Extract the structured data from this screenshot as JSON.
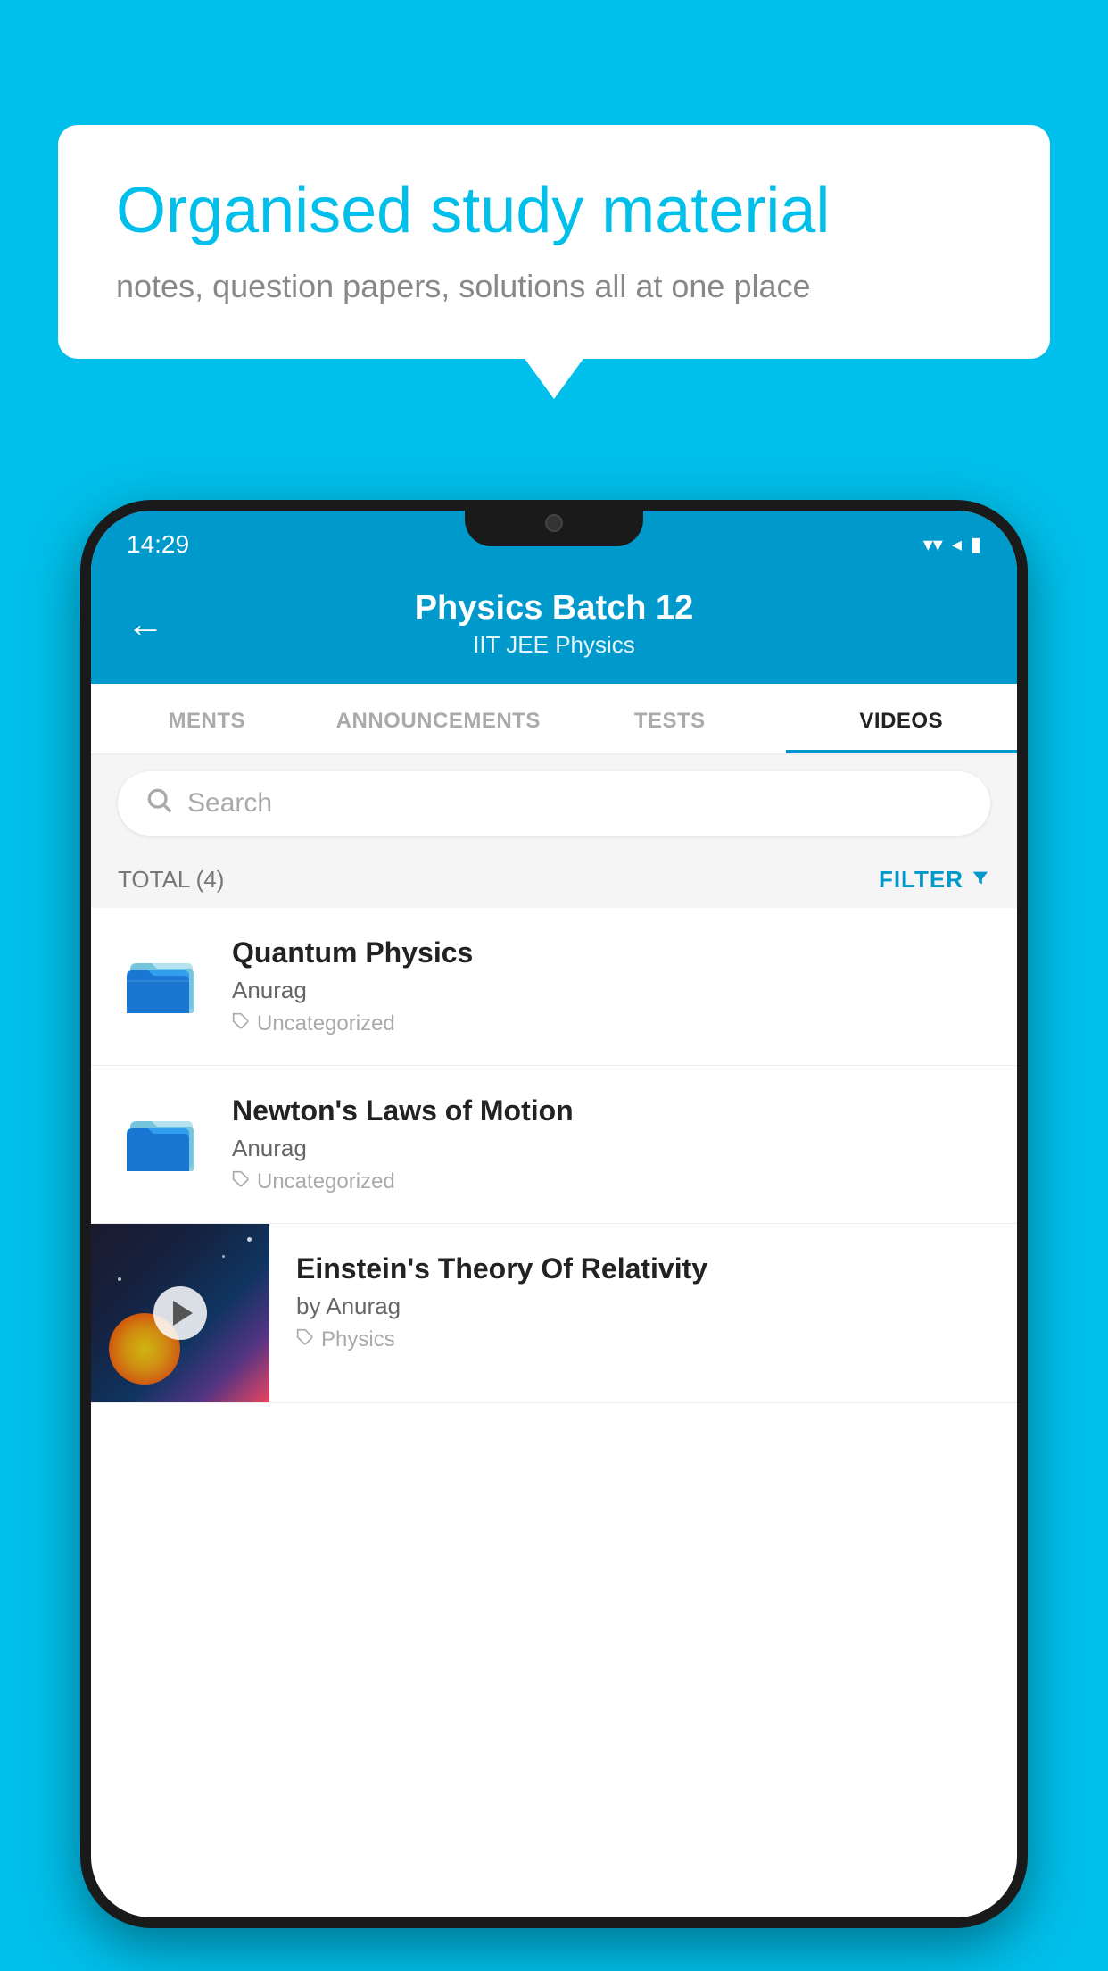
{
  "background": {
    "color": "#00BFEA"
  },
  "speech_bubble": {
    "title": "Organised study material",
    "subtitle": "notes, question papers, solutions all at one place"
  },
  "phone": {
    "status_bar": {
      "time": "14:29",
      "wifi": "▾",
      "signal": "▴",
      "battery": "▮"
    },
    "header": {
      "back_label": "←",
      "title": "Physics Batch 12",
      "subtitle": "IIT JEE   Physics"
    },
    "tabs": [
      {
        "label": "MENTS",
        "active": false
      },
      {
        "label": "ANNOUNCEMENTS",
        "active": false
      },
      {
        "label": "TESTS",
        "active": false
      },
      {
        "label": "VIDEOS",
        "active": true
      }
    ],
    "search": {
      "placeholder": "Search"
    },
    "filter_bar": {
      "total_label": "TOTAL (4)",
      "filter_label": "FILTER"
    },
    "videos": [
      {
        "id": "quantum-physics",
        "title": "Quantum Physics",
        "author": "Anurag",
        "tag": "Uncategorized",
        "has_thumbnail": false
      },
      {
        "id": "newtons-laws",
        "title": "Newton's Laws of Motion",
        "author": "Anurag",
        "tag": "Uncategorized",
        "has_thumbnail": false
      },
      {
        "id": "einsteins-theory",
        "title": "Einstein's Theory Of Relativity",
        "author": "by Anurag",
        "tag": "Physics",
        "has_thumbnail": true
      }
    ]
  }
}
